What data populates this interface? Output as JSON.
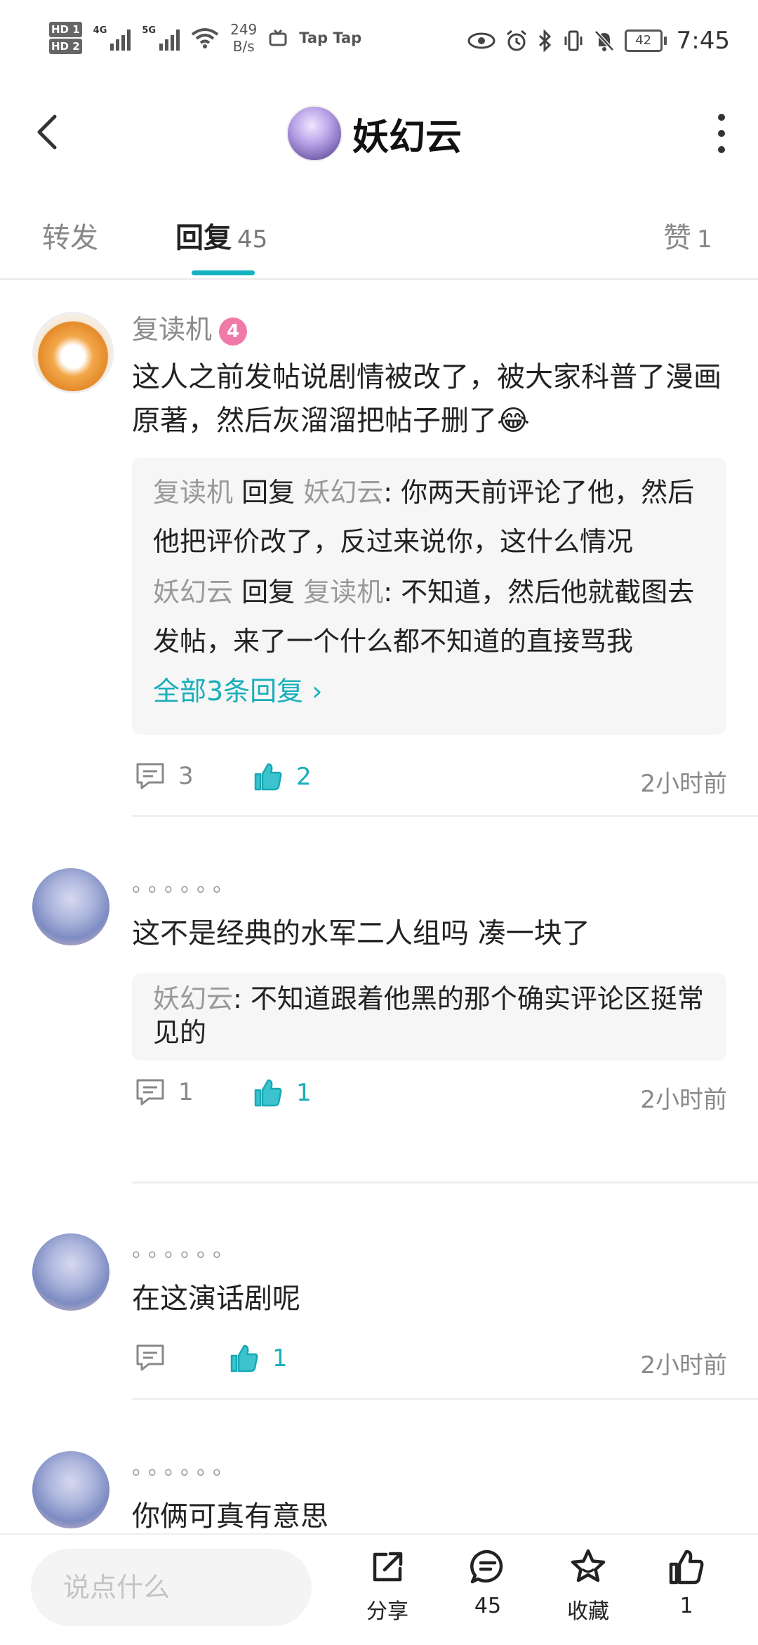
{
  "status_bar": {
    "hd1": "HD 1",
    "hd2": "HD 2",
    "net1": "4G",
    "net2": "5G",
    "speed_value": "249",
    "speed_unit": "B/s",
    "app_label": "Tap Tap",
    "battery": "42",
    "time": "7:45"
  },
  "header": {
    "title": "妖幻云"
  },
  "tabs": [
    {
      "label": "转发",
      "count": ""
    },
    {
      "label": "回复",
      "count": "45"
    },
    {
      "label": "赞",
      "count": "1"
    }
  ],
  "comments": [
    {
      "username": "复读机",
      "level": "4",
      "text": "这人之前发帖说剧情被改了，被大家科普了漫画原著，然后灰溜溜把帖子删了😂",
      "replies": [
        {
          "from": "复读机",
          "verb": "回复",
          "to": "妖幻云",
          "text": ": 你两天前评论了他，然后他把评价改了，反过来说你，这什么情况"
        },
        {
          "from": "妖幻云",
          "verb": "回复",
          "to": "复读机",
          "text": ": 不知道，然后他就截图去发帖，来了一个什么都不知道的直接骂我"
        }
      ],
      "all_replies": "全部3条回复 ›",
      "reply_count": "3",
      "like_count": "2",
      "time": "2小时前"
    },
    {
      "username": "。。。。。。",
      "text": "这不是经典的水军二人组吗 凑一块了",
      "replies": [
        {
          "from": "妖幻云",
          "verb": "",
          "to": "",
          "text": ": 不知道跟着他黑的那个确实评论区挺常见的"
        }
      ],
      "reply_count": "1",
      "like_count": "1",
      "time": "2小时前"
    },
    {
      "username": "。。。。。。",
      "text": "在这演话剧呢",
      "reply_count": "",
      "like_count": "1",
      "time": "2小时前"
    },
    {
      "username": "。。。。。。",
      "text": "你俩可真有意思"
    }
  ],
  "bottom_bar": {
    "input_placeholder": "说点什么",
    "share_label": "分享",
    "comment_count": "45",
    "favorite_label": "收藏",
    "like_count": "1"
  },
  "colors": {
    "accent": "#19aebb",
    "level_badge": "#f07aa7",
    "muted_text": "#8a8a8a"
  }
}
